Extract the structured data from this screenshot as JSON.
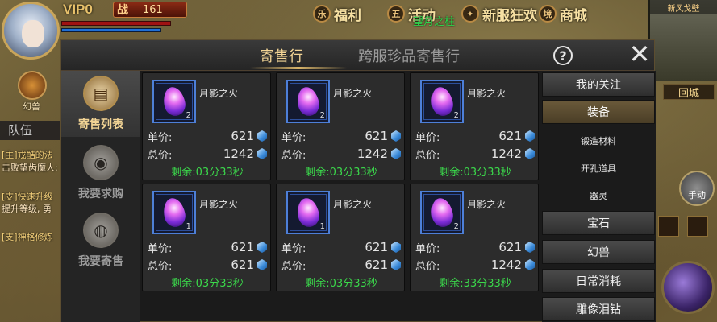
{
  "hud": {
    "vip": "VIP0",
    "power_icon": "战",
    "power": "161",
    "top_menu": [
      {
        "badge": "乐",
        "label": "福利"
      },
      {
        "badge": "五",
        "label": "活动"
      },
      {
        "badge": "",
        "label": "新服狂欢"
      },
      {
        "badge": "境",
        "label": "商城"
      }
    ],
    "center_text": "望月之柱",
    "minimap_title": "新风戈壁",
    "return_city": "回城",
    "pet": "幻兽",
    "team": "队伍",
    "chat": [
      "[主]戎酷的法",
      "击败望齿魔人:",
      "[支]快速升级",
      "提升等级, 勇",
      "[支]神格修炼"
    ],
    "auto": "手动"
  },
  "panel": {
    "tabs": [
      "寄售行",
      "跨服珍品寄售行"
    ],
    "help": "?",
    "close": "✕",
    "sidebar": [
      {
        "label": "寄售列表",
        "icon": "scroll-icon"
      },
      {
        "label": "我要求购",
        "icon": "money-bag-icon"
      },
      {
        "label": "我要寄售",
        "icon": "coin-bag-icon"
      }
    ],
    "price_label": "单价:",
    "total_label": "总价:",
    "items": [
      {
        "name": "月影之火",
        "count": "2",
        "unit": "621",
        "total": "1242",
        "remain": "剩余:03分33秒"
      },
      {
        "name": "月影之火",
        "count": "2",
        "unit": "621",
        "total": "1242",
        "remain": "剩余:03分33秒"
      },
      {
        "name": "月影之火",
        "count": "2",
        "unit": "621",
        "total": "1242",
        "remain": "剩余:03分33秒"
      },
      {
        "name": "月影之火",
        "count": "1",
        "unit": "621",
        "total": "621",
        "remain": "剩余:03分33秒"
      },
      {
        "name": "月影之火",
        "count": "1",
        "unit": "621",
        "total": "621",
        "remain": "剩余:03分33秒"
      },
      {
        "name": "月影之火",
        "count": "2",
        "unit": "621",
        "total": "1242",
        "remain": "剩余:33分33秒"
      }
    ],
    "right_nav": [
      {
        "label": "我的关注",
        "type": "btn"
      },
      {
        "label": "装备",
        "type": "btn",
        "active": true
      },
      {
        "label": "锻造材料",
        "type": "sub"
      },
      {
        "label": "开孔道具",
        "type": "sub"
      },
      {
        "label": "器灵",
        "type": "sub"
      },
      {
        "label": "宝石",
        "type": "btn"
      },
      {
        "label": "幻兽",
        "type": "btn"
      },
      {
        "label": "日常消耗",
        "type": "btn"
      },
      {
        "label": "雕像泪钻",
        "type": "btn"
      }
    ]
  }
}
